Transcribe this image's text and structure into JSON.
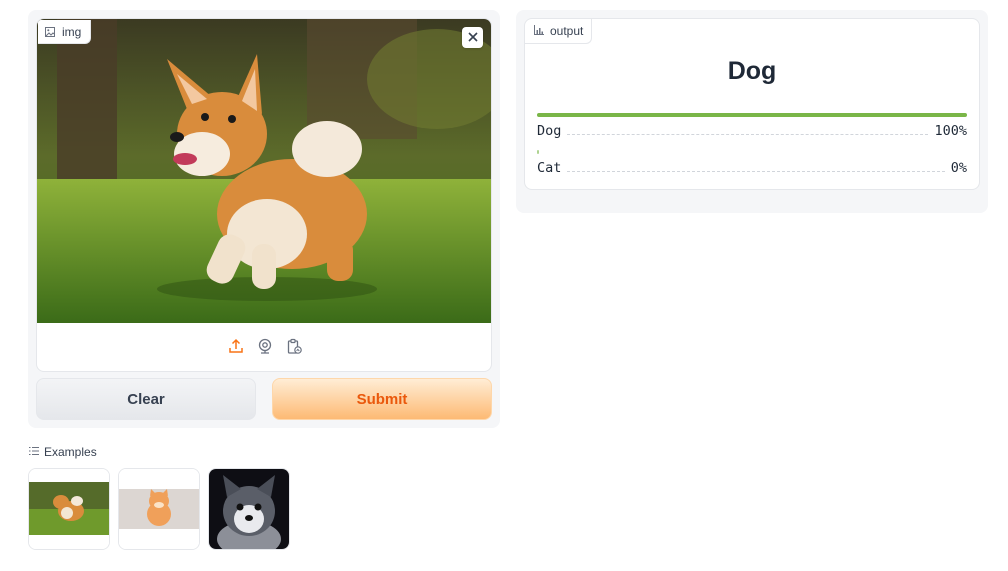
{
  "input": {
    "label": "img",
    "icons": [
      "image-icon",
      "close-icon",
      "upload-icon",
      "webcam-icon",
      "clipboard-icon"
    ]
  },
  "buttons": {
    "clear": "Clear",
    "submit": "Submit"
  },
  "output": {
    "label": "output",
    "prediction": "Dog",
    "confidences": [
      {
        "label": "Dog",
        "value": "100%",
        "fraction": 1.0
      },
      {
        "label": "Cat",
        "value": "0%",
        "fraction": 0.0
      }
    ]
  },
  "examples": {
    "label": "Examples",
    "items": [
      "corgi-thumbnail",
      "kitten-thumbnail",
      "husky-puppy-thumbnail"
    ]
  },
  "colors": {
    "accent_orange": "#ea580c",
    "confidence_green": "#7ab648",
    "panel_bg": "#f5f6f8"
  }
}
